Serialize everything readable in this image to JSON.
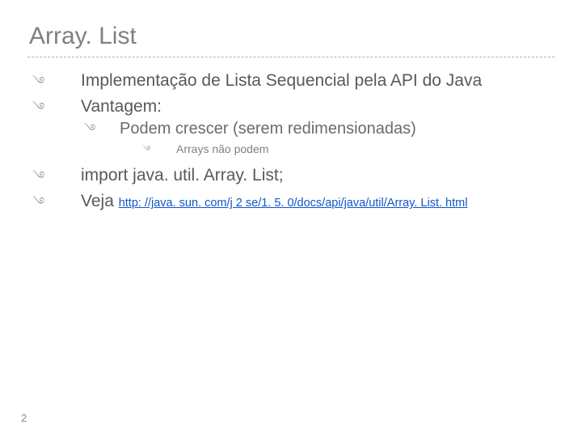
{
  "title": "Array. List",
  "bulletGlyph": "࿓",
  "lines": {
    "l1": "Implementação de Lista Sequencial pela API do Java",
    "l2": "Vantagem:",
    "l2a": "Podem crescer (serem redimensionadas)",
    "l2a1": "Arrays não podem",
    "l3": "import  java. util. Array. List;",
    "l4_prefix": "Veja ",
    "l4_link": "http: //java. sun. com/j 2 se/1. 5. 0/docs/api/java/util/Array. List. html"
  },
  "pageNumber": "2"
}
